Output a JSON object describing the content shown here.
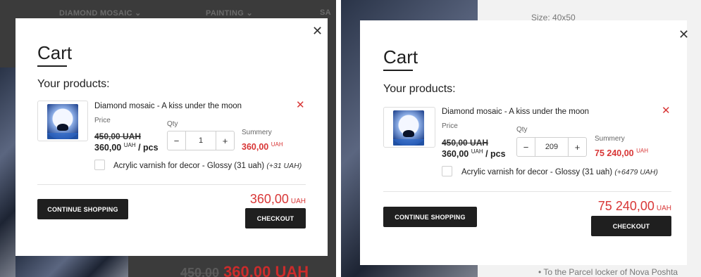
{
  "background": {
    "nav_item_1": "DIAMOND MOSAIC",
    "nav_item_2": "PAINTING",
    "nav_item_3": "SA",
    "old_price": "450.00",
    "price": "360.00 UAH",
    "size_label": "Size:",
    "size_value": "40x50",
    "delivery_option": "To the Parcel locker of Nova Poshta"
  },
  "carts": [
    {
      "title": "Cart",
      "products_heading": "Your products:",
      "product_name": "Diamond mosaic - A kiss under the moon",
      "price_label": "Price",
      "old_price": "450,00 UAH",
      "unit_price": "360,00",
      "unit_currency": "UAH",
      "unit_suffix": "/ pcs",
      "qty_label": "Qty",
      "qty_value": "1",
      "summary_label": "Summery",
      "summary_value": "360,00",
      "summary_currency": "UAH",
      "addon_label": "Acrylic varnish for decor - Glossy (31 uah)",
      "addon_extra": "(+31 UAH)",
      "total_value": "360,00",
      "total_currency": "UAH",
      "continue_label": "CONTINUE SHOPPING",
      "checkout_label": "CHECKOUT"
    },
    {
      "title": "Cart",
      "products_heading": "Your products:",
      "product_name": "Diamond mosaic - A kiss under the moon",
      "price_label": "Price",
      "old_price": "450,00 UAH",
      "unit_price": "360,00",
      "unit_currency": "UAH",
      "unit_suffix": "/ pcs",
      "qty_label": "Qty",
      "qty_value": "209",
      "summary_label": "Summery",
      "summary_value": "75 240,00",
      "summary_currency": "UAH",
      "addon_label": "Acrylic varnish for decor - Glossy (31 uah)",
      "addon_extra": "(+6479 UAH)",
      "total_value": "75 240,00",
      "total_currency": "UAH",
      "continue_label": "CONTINUE SHOPPING",
      "checkout_label": "CHECKOUT"
    }
  ],
  "icons": {
    "close": "close-icon",
    "remove": "remove-icon",
    "chevron": "chevron-down-icon"
  },
  "colors": {
    "accent_red": "#d83636",
    "button_dark": "#1f1f1f",
    "overlay": "#3b3b3b"
  }
}
